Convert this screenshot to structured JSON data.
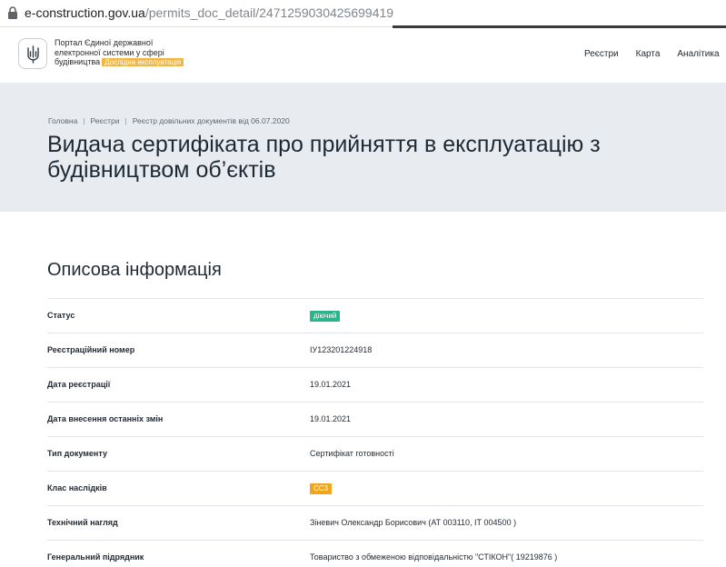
{
  "browser": {
    "url_host": "e-construction.gov.ua",
    "url_path": "/permits_doc_detail/2471259030425699419"
  },
  "header": {
    "portal_name": "Портал Єдиної державної електронної системи у сфері будівництва",
    "beta_badge": "Дослідна експлуатація",
    "nav": [
      "Реєстри",
      "Карта",
      "Аналітика"
    ]
  },
  "breadcrumb": [
    "Головна",
    "Реєстри",
    "Реєстр довільних документів від 06.07.2020"
  ],
  "page_title": [
    "Видача сертифіката про прийняття в експлуатацію з",
    "будівництвом об’єктів"
  ],
  "section_title": "Описова інформація",
  "info_rows": [
    {
      "label": "Статус",
      "value": "діючий",
      "tag_color": "#2bb38a"
    },
    {
      "label": "Реєстраційний номер",
      "value": "ІУ123201224918"
    },
    {
      "label": "Дата реєстрації",
      "value": "19.01.2021"
    },
    {
      "label": "Дата внесення останніх змін",
      "value": "19.01.2021"
    },
    {
      "label": "Тип документу",
      "value": "Сертифікат готовності"
    },
    {
      "label": "Клас наслідків",
      "value": "СС3",
      "tag_color": "#f2a51a"
    },
    {
      "label": "Технічний нагляд",
      "value": "Зіневич Олександр Борисович (АТ 003110, ІТ 004500 )"
    },
    {
      "label": "Генеральний підрядник",
      "value": "Товариство з обмеженою відповідальністю \"СТІКОН\"( 19219876 )"
    }
  ],
  "colors": {
    "hero_bg": "#e8ecf1",
    "badge_bg": "#f2b544",
    "status_active": "#2bb38a",
    "class_tag": "#f2a51a"
  },
  "icons": {
    "lock": "lock-icon",
    "logo": "trident-icon"
  }
}
